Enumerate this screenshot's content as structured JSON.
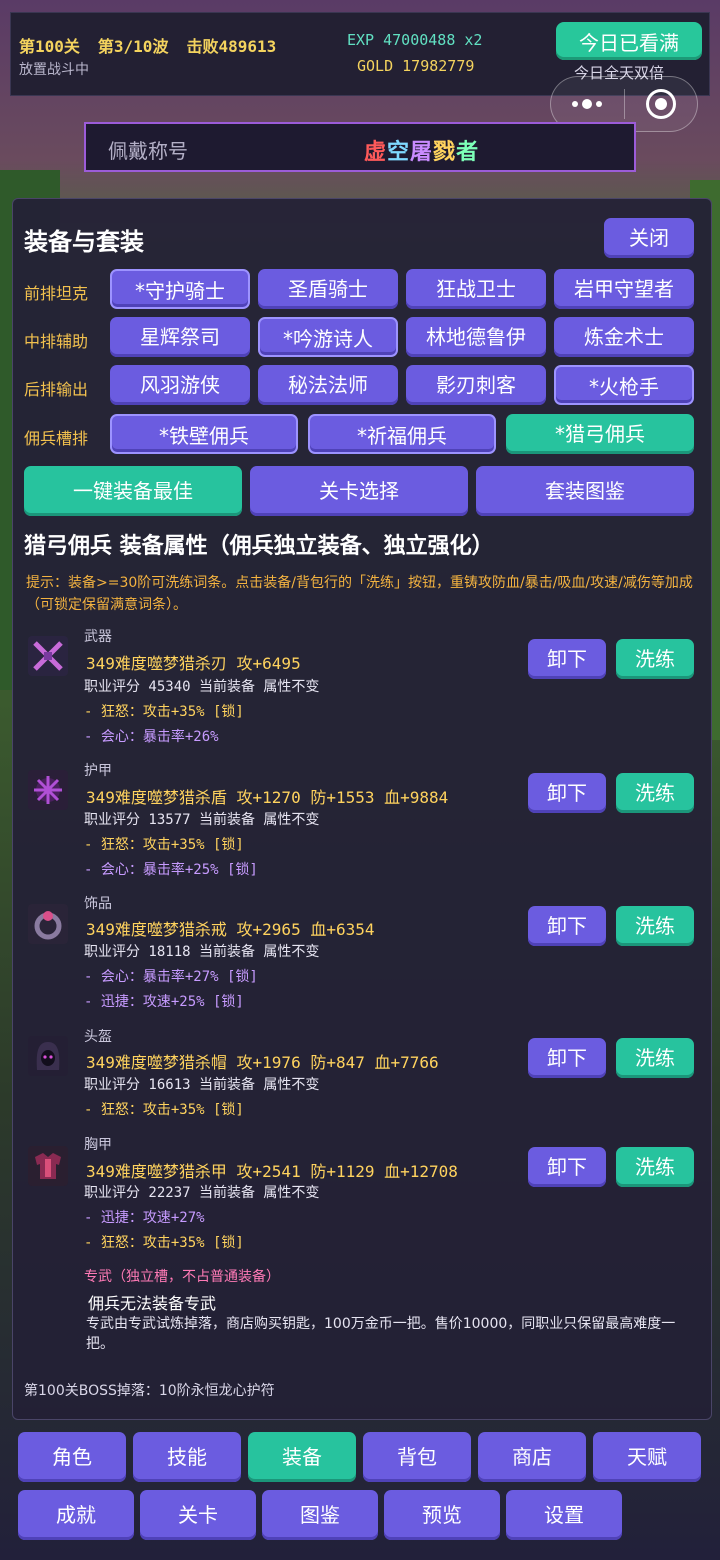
{
  "hud": {
    "stage": "第100关",
    "wave": "第3/10波",
    "defeated": "击败489613",
    "status": "放置战斗中",
    "exp": "EXP 47000488 x2",
    "gold": "GOLD 17982779",
    "watch_button": "今日已看满",
    "double_note": "今日全天双倍"
  },
  "title": {
    "label": "佩戴称号",
    "chars": [
      "虚",
      "空",
      "屠",
      "戮",
      "者"
    ]
  },
  "panel": {
    "ghost_text": "第3/10波",
    "title": "装备与套装",
    "close": "关闭",
    "rows": [
      {
        "label": "前排坦克",
        "classes": [
          "*守护骑士",
          "圣盾骑士",
          "狂战卫士",
          "岩甲守望者"
        ]
      },
      {
        "label": "中排辅助",
        "classes": [
          "星辉祭司",
          "*吟游诗人",
          "林地德鲁伊",
          "炼金术士"
        ]
      },
      {
        "label": "后排输出",
        "classes": [
          "风羽游侠",
          "秘法法师",
          "影刃刺客",
          "*火枪手"
        ]
      },
      {
        "label": "佣兵槽排",
        "classes": [
          "*铁壁佣兵",
          "*祈福佣兵",
          "*猎弓佣兵"
        ]
      }
    ],
    "actions": [
      "一键装备最佳",
      "关卡选择",
      "套装图鉴"
    ],
    "section_title": "猎弓佣兵 装备属性（佣兵独立装备、独立强化）",
    "hint": "提示：装备>=30阶可洗练词条。点击装备/背包行的「洗练」按钮，重铸攻防血/暴击/吸血/攻速/减伤等加成（可锁定保留满意词条）。",
    "unequip": "卸下",
    "reroll": "洗练"
  },
  "equipment": [
    {
      "slot": "武器",
      "name": "349难度噬梦猎杀刃  攻+6495",
      "meta": "职业评分 45340  当前装备  属性不变",
      "attrs": [
        {
          "text": "- 狂怒：攻击+35% [锁]",
          "tone": "gold"
        },
        {
          "text": "- 会心：暴击率+26%",
          "tone": "purple"
        }
      ],
      "icon": "sword-icon"
    },
    {
      "slot": "护甲",
      "name": "349难度噬梦猎杀盾  攻+1270 防+1553 血+9884",
      "meta": "职业评分 13577  当前装备  属性不变",
      "attrs": [
        {
          "text": "- 狂怒：攻击+35% [锁]",
          "tone": "gold"
        },
        {
          "text": "- 会心：暴击率+25% [锁]",
          "tone": "purple"
        }
      ],
      "icon": "shield-icon"
    },
    {
      "slot": "饰品",
      "name": "349难度噬梦猎杀戒  攻+2965 血+6354",
      "meta": "职业评分 18118  当前装备  属性不变",
      "attrs": [
        {
          "text": "- 会心：暴击率+27% [锁]",
          "tone": "purple"
        },
        {
          "text": "- 迅捷：攻速+25% [锁]",
          "tone": "purple"
        }
      ],
      "icon": "ring-icon"
    },
    {
      "slot": "头盔",
      "name": "349难度噬梦猎杀帽  攻+1976 防+847 血+7766",
      "meta": "职业评分 16613  当前装备  属性不变",
      "attrs": [
        {
          "text": "- 狂怒：攻击+35% [锁]",
          "tone": "gold"
        }
      ],
      "icon": "hood-icon"
    },
    {
      "slot": "胸甲",
      "name": "349难度噬梦猎杀甲  攻+2541 防+1129 血+12708",
      "meta": "职业评分 22237  当前装备  属性不变",
      "attrs": [
        {
          "text": "- 迅捷：攻速+27%",
          "tone": "purple"
        },
        {
          "text": "- 狂怒：攻击+35% [锁]",
          "tone": "gold"
        }
      ],
      "icon": "chest-armor-icon"
    }
  ],
  "exclusive": {
    "title": "专武（独立槽，不占普通装备）",
    "none": "佣兵无法装备专武",
    "desc": "专武由专武试炼掉落，商店购买钥匙，100万金币一把。售价10000，同职业只保留最高难度一把。"
  },
  "drop_note": "第100关BOSS掉落：10阶永恒龙心护符",
  "nav": {
    "row1": [
      "角色",
      "技能",
      "装备",
      "背包",
      "商店",
      "天赋"
    ],
    "row2": [
      "成就",
      "关卡",
      "图鉴",
      "预览",
      "设置"
    ]
  },
  "colors": {
    "accent_purple": "#6b5ce0",
    "accent_green": "#27c39e",
    "gold_text": "#ffd35e",
    "label_text": "#f2c14e"
  }
}
